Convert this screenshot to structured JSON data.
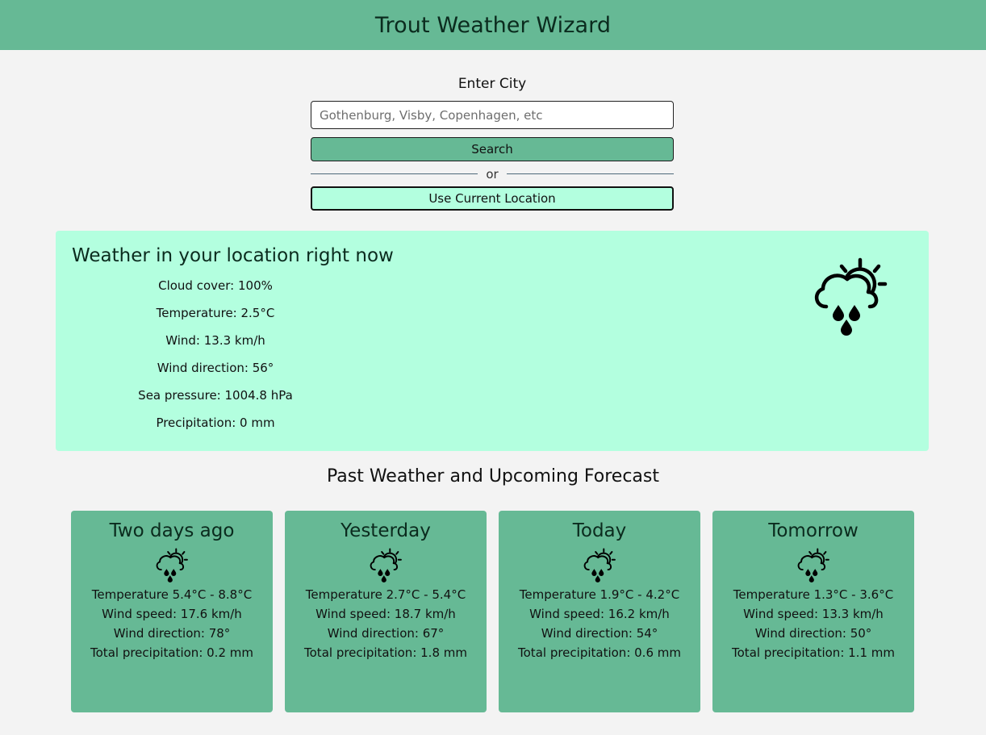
{
  "header": {
    "title": "Trout Weather Wizard"
  },
  "search": {
    "label": "Enter City",
    "placeholder": "Gothenburg, Visby, Copenhagen, etc",
    "value": "",
    "search_button": "Search",
    "or_text": "or",
    "location_button": "Use Current Location"
  },
  "current": {
    "title": "Weather in your location right now",
    "icon": "sun-cloud-rain-icon",
    "stats": [
      "Cloud cover: 100%",
      "Temperature: 2.5°C",
      "Wind: 13.3 km/h",
      "Wind direction: 56°",
      "Sea pressure: 1004.8 hPa",
      "Precipitation: 0 mm"
    ]
  },
  "forecast": {
    "title": "Past Weather and Upcoming Forecast",
    "days": [
      {
        "label": "Two days ago",
        "icon": "sun-cloud-rain-icon",
        "temperature": "Temperature 5.4°C - 8.8°C",
        "wind_speed": "Wind speed: 17.6 km/h",
        "wind_direction": "Wind direction: 78°",
        "precipitation": "Total precipitation: 0.2 mm"
      },
      {
        "label": "Yesterday",
        "icon": "sun-cloud-rain-icon",
        "temperature": "Temperature 2.7°C - 5.4°C",
        "wind_speed": "Wind speed: 18.7 km/h",
        "wind_direction": "Wind direction: 67°",
        "precipitation": "Total precipitation: 1.8 mm"
      },
      {
        "label": "Today",
        "icon": "sun-cloud-rain-icon",
        "temperature": "Temperature 1.9°C - 4.2°C",
        "wind_speed": "Wind speed: 16.2 km/h",
        "wind_direction": "Wind direction: 54°",
        "precipitation": "Total precipitation: 0.6 mm"
      },
      {
        "label": "Tomorrow",
        "icon": "sun-cloud-rain-icon",
        "temperature": "Temperature 1.3°C - 3.6°C",
        "wind_speed": "Wind speed: 13.3 km/h",
        "wind_direction": "Wind direction: 50°",
        "precipitation": "Total precipitation: 1.1 mm"
      }
    ]
  },
  "colors": {
    "header_bg": "#66b995",
    "panel_bg": "#b3ffdf",
    "card_bg": "#66b995",
    "page_bg": "#f3f3f3"
  }
}
